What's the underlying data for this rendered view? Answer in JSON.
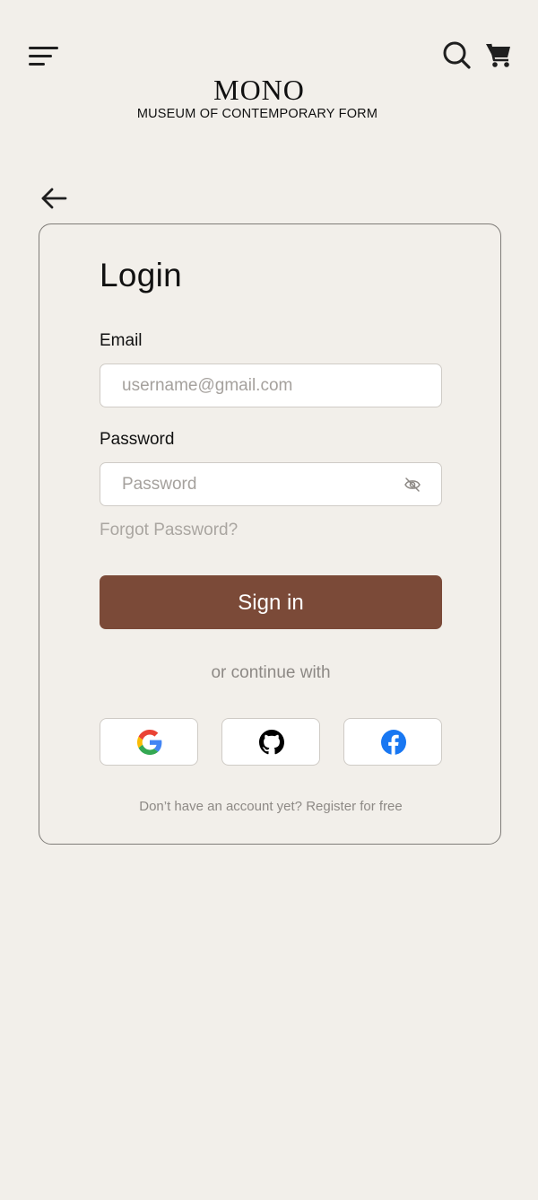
{
  "brand": {
    "title": "MONO",
    "subtitle": "MUSEUM OF CONTEMPORARY FORM"
  },
  "header": {
    "menu_icon": "hamburger-menu-icon",
    "search_icon": "search-icon",
    "cart_icon": "shopping-cart-icon",
    "back_icon": "arrow-left-icon"
  },
  "login": {
    "title": "Login",
    "email_label": "Email",
    "email_placeholder": "username@gmail.com",
    "password_label": "Password",
    "password_placeholder": "Password",
    "password_toggle_icon": "eye-off-icon",
    "forgot_label": "Forgot Password?",
    "signin_label": "Sign in",
    "or_label": "or continue with",
    "social": [
      {
        "name": "Google",
        "icon": "google-icon"
      },
      {
        "name": "GitHub",
        "icon": "github-icon"
      },
      {
        "name": "Facebook",
        "icon": "facebook-icon"
      }
    ],
    "register_prompt": "Don’t have an account yet?",
    "register_link": "Register for free"
  },
  "colors": {
    "background": "#f2efea",
    "primary_button": "#7b4a38",
    "card_border": "#7f7c78",
    "muted_text": "#8d8985",
    "facebook_blue": "#1877f2"
  }
}
